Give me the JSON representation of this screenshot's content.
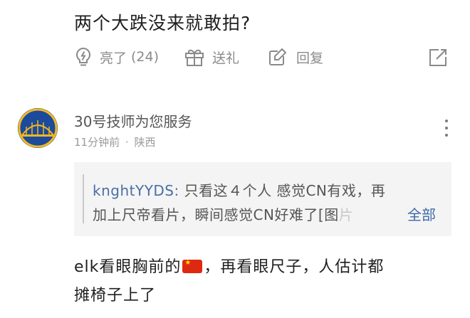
{
  "question": {
    "text": "两个大跌没来就敢拍?"
  },
  "actions": {
    "like_label": "亮了",
    "like_count": "(24)",
    "gift_label": "送礼",
    "reply_label": "回复"
  },
  "comment": {
    "username": "30号技师为您服务",
    "time": "11分钟前",
    "separator": "·",
    "location": "陕西",
    "quote": {
      "author": "knghtYYDS:",
      "line1": "只看这４个人 感觉CN有戏，再",
      "line2": "加上尺帝看片，瞬间感觉CN好难了[图",
      "line2_cut": "片",
      "expand_label": "全部"
    },
    "body_line1_a": "elk看眼胸前的",
    "body_line1_b": "，再看眼尺子，人估计都",
    "body_line2": "摊椅子上了"
  },
  "colors": {
    "accent_blue": "#3d6aa8",
    "flag_red": "#de2910",
    "flag_star": "#ffde00",
    "avatar_bg": "#1c4a9c"
  },
  "icons": [
    "lightbulb-icon",
    "gift-icon",
    "reply-edit-icon",
    "share-icon",
    "more-icon",
    "flag-icon"
  ]
}
